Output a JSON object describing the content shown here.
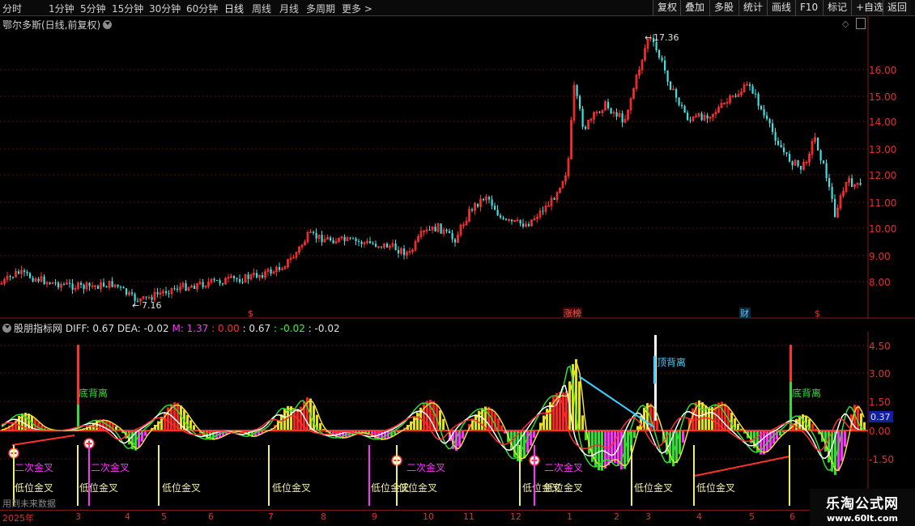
{
  "toolbar": {
    "timeframes": [
      "分时",
      "1分钟",
      "5分钟",
      "15分钟",
      "30分钟",
      "60分钟",
      "日线",
      "周线",
      "月线",
      "多周期",
      "更多 >"
    ],
    "active_timeframe": "日线",
    "buttons": [
      "复权",
      "叠加",
      "多股",
      "统计",
      "画线",
      "F10",
      "标记",
      "+自选",
      "返回"
    ]
  },
  "main_chart": {
    "title": "鄂尔多斯(日线,前复权)",
    "price_axis": [
      "16.00",
      "15.00",
      "14.00",
      "13.00",
      "12.00",
      "11.00",
      "10.00",
      "9.00",
      "8.00"
    ],
    "high_label": "17.36",
    "low_label": "7.16",
    "event_markers": [
      "$",
      "涨榜",
      "财",
      "$"
    ]
  },
  "indicator": {
    "name": "股朋指标网",
    "values_line": [
      {
        "text": "DIFF: 0.67",
        "color": "#e0e0e0"
      },
      {
        "text": "DEA: -0.02",
        "color": "#e0e0e0"
      },
      {
        "text": "M: 1.37",
        "color": "#ff33ff"
      },
      {
        "text": ": 0.00",
        "color": "#ff3030"
      },
      {
        "text": ": 0.67",
        "color": "#e0e0e0"
      },
      {
        "text": ": -0.02",
        "color": "#30ff30"
      },
      {
        "text": ": -0.02",
        "color": "#e0e0e0"
      }
    ],
    "axis": [
      "4.50",
      "3.00",
      "1.50",
      "0.00",
      "-1.50"
    ],
    "current_value": "0.37",
    "labels": {
      "bottom_divergence": "底背离",
      "top_divergence": "顶背离",
      "second_cross": "二次金叉",
      "low_cross": "低位金叉"
    }
  },
  "date_axis": {
    "year": "2025年",
    "months": [
      "3",
      "4",
      "5",
      "6",
      "7",
      "8",
      "9",
      "10",
      "11",
      "12",
      "1",
      "2",
      "3",
      "4",
      "5",
      "6"
    ]
  },
  "footer_note": "用到未来数据",
  "watermark": {
    "line1": "乐淘公式网",
    "line2": "www.60lt.com"
  }
}
